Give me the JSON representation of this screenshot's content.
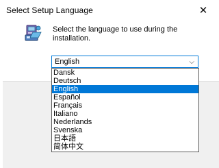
{
  "window": {
    "title": "Select Setup Language",
    "close_glyph": "✕"
  },
  "prompt": {
    "text": "Select the language to use during the installation."
  },
  "language_select": {
    "value": "English",
    "arrow_glyph": "⌵",
    "options": [
      "Dansk",
      "Deutsch",
      "English",
      "Español",
      "Français",
      "Italiano",
      "Nederlands",
      "Svenska",
      "日本語",
      "简体中文"
    ],
    "selected_index": 2
  },
  "icons": {
    "app": "installer-icon",
    "close": "close-icon",
    "dropdown": "chevron-down-icon"
  },
  "colors": {
    "accent": "#0078d7",
    "footer": "#f0f0f0"
  }
}
